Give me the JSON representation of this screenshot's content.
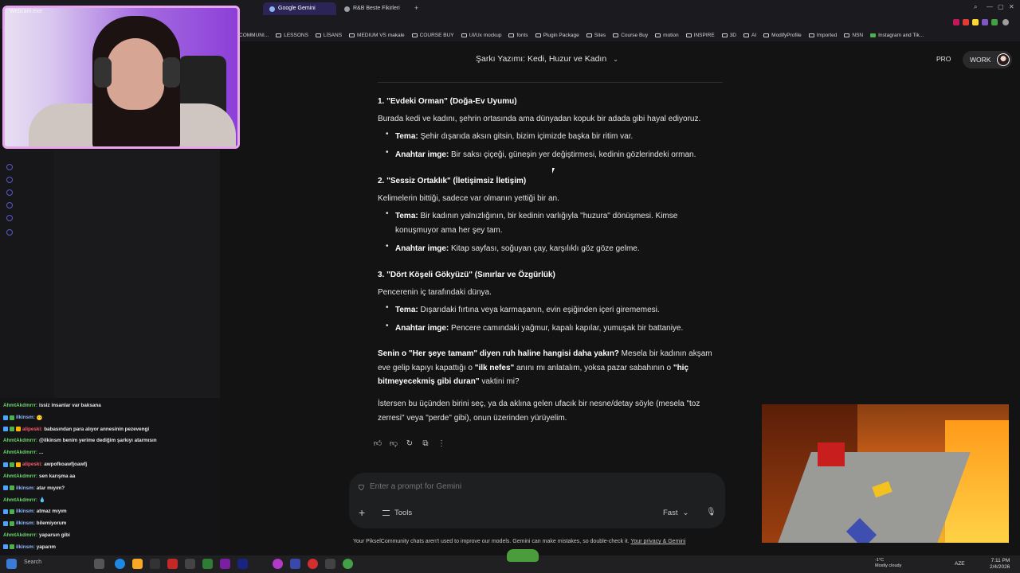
{
  "browser": {
    "tabs": [
      {
        "label": "Google Gemini",
        "active": true
      },
      {
        "label": "R&B Beste Fikirleri",
        "active": false
      }
    ],
    "new_tab": "+",
    "bookmarks": [
      "COMMUNI...",
      "LESSONS",
      "LİSANS",
      "MEDIUM VS makale",
      "COURSE BUY",
      "UI/Ux mockup",
      "fonts",
      "Plugin Package",
      "Sites",
      "Course Buy",
      "motion",
      "INSPIRE",
      "3D",
      "AI",
      "ModifyProfile",
      "Imported",
      "NSN",
      "Instagram and Tik..."
    ]
  },
  "webcam": {
    "label": "Webcam.exe"
  },
  "header": {
    "conversation_title": "Şarkı Yazımı: Kedi, Huzur ve Kadın",
    "pro": "PRO",
    "work": "WORK"
  },
  "response": {
    "s1_title": "1. \"Evdeki Orman\" (Doğa-Ev Uyumu)",
    "s1_desc": "Burada kedi ve kadını, şehrin ortasında ama dünyadan kopuk bir adada gibi hayal ediyoruz.",
    "s1_b1_label": "Tema:",
    "s1_b1_text": " Şehir dışarıda aksın gitsin, bizim içimizde başka bir ritim var.",
    "s1_b2_label": "Anahtar imge:",
    "s1_b2_text": " Bir saksı çiçeği, güneşin yer değiştirmesi, kedinin gözlerindeki orman.",
    "s2_title": "2. \"Sessiz Ortaklık\" (İletişimsiz İletişim)",
    "s2_desc": "Kelimelerin bittiği, sadece var olmanın yettiği bir an.",
    "s2_b1_label": "Tema:",
    "s2_b1_text": " Bir kadının yalnızlığının, bir kedinin varlığıyla \"huzura\" dönüşmesi. Kimse konuşmuyor ama her şey tam.",
    "s2_b2_label": "Anahtar imge:",
    "s2_b2_text": " Kitap sayfası, soğuyan çay, karşılıklı göz göze gelme.",
    "s3_title": "3. \"Dört Köşeli Gökyüzü\" (Sınırlar ve Özgürlük)",
    "s3_desc": "Pencerenin iç tarafındaki dünya.",
    "s3_b1_label": "Tema:",
    "s3_b1_text": " Dışarıdaki fırtına veya karmaşanın, evin eşiğinden içeri girememesi.",
    "s3_b2_label": "Anahtar imge:",
    "s3_b2_text": " Pencere camındaki yağmur, kapalı kapılar, yumuşak bir battaniye.",
    "q_bold1": "Senin o \"Her şeye tamam\" diyen ruh haline hangisi daha yakın?",
    "q_t1": " Mesela bir kadının akşam eve gelip kapıyı kapattığı o ",
    "q_bold2": "\"ilk nefes\"",
    "q_t2": " anını mı anlatalım, yoksa pazar sabahının o ",
    "q_bold3": "\"hiç bitmeyecekmiş gibi duran\"",
    "q_t3": " vaktini mi?",
    "closing": "İstersen bu üçünden birini seç, ya da aklına gelen ufacık bir nesne/detay söyle (mesela \"toz zerresi\" veya \"perde\" gibi), onun üzerinden yürüyelim."
  },
  "prompt": {
    "placeholder": "Enter a prompt for Gemini",
    "tools": "Tools",
    "mode": "Fast"
  },
  "disclaimer": {
    "text": "Your PikselCommunity chats aren't used to improve our models. Gemini can make mistakes, so double-check it. ",
    "link": "Your privacy & Gemini"
  },
  "chat": [
    {
      "user": "AhmtAkdmrrr:",
      "msg": "issiz insanlar var baksana",
      "color": "green"
    },
    {
      "user": "ilkinsm:",
      "msg": "😶",
      "color": "blue"
    },
    {
      "user": "alipeski:",
      "msg": "babasından para alıyor annesinin pezevengi",
      "color": "red"
    },
    {
      "user": "AhmtAkdmrrr:",
      "msg": "@ilkinsm benim yerime dediğim şarkıyı atarmısın",
      "color": "green"
    },
    {
      "user": "AhmtAkdmrrr:",
      "msg": "...",
      "color": "green"
    },
    {
      "user": "alipeski:",
      "msg": "awpofkoawfjoawfj",
      "color": "red"
    },
    {
      "user": "AhmtAkdmrrr:",
      "msg": "sen karışma aa",
      "color": "green"
    },
    {
      "user": "ilkinsm:",
      "msg": "atar mıyım?",
      "color": "blue"
    },
    {
      "user": "AhmtAkdmrrr:",
      "msg": "💧",
      "color": "green"
    },
    {
      "user": "ilkinsm:",
      "msg": "atmaz mıyım",
      "color": "blue"
    },
    {
      "user": "ilkinsm:",
      "msg": "bilemiyorum",
      "color": "blue"
    },
    {
      "user": "AhmtAkdmrrr:",
      "msg": "yaparsın gibi",
      "color": "green"
    },
    {
      "user": "ilkinsm:",
      "msg": "yaparım",
      "color": "blue"
    }
  ],
  "taskbar": {
    "search": "Search",
    "weather_temp": "-1°C",
    "weather_desc": "Mostly cloudy",
    "time": "7:11 PM",
    "date": "2/4/2026",
    "lang": "AZE"
  },
  "colors": {
    "background": "#131314",
    "active_tab": "#2a2556",
    "webcam_border": "#e9a6ef",
    "chat_green": "#6cd66c",
    "chat_blue": "#8fb8ff",
    "chat_red": "#ff5a6b"
  }
}
